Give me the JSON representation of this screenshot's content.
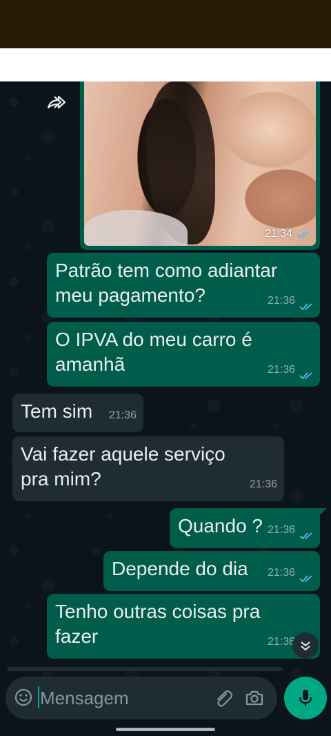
{
  "colors": {
    "outgoing_bubble": "#005c4b",
    "incoming_bubble": "#202c33",
    "chat_background": "#0b141a",
    "read_check": "#53bdeb",
    "accent": "#00a884"
  },
  "image_message": {
    "time": "21:34",
    "status_icon": "double-check-icon"
  },
  "messages": [
    {
      "direction": "outgoing",
      "line1": "Patrão tem como adiantar",
      "line2": "meu pagamento?",
      "time": "21:36"
    },
    {
      "direction": "outgoing",
      "line1": "O IPVA do meu carro é",
      "line2": "amanhã",
      "time": "21:36"
    },
    {
      "direction": "incoming",
      "line1": "Tem sim",
      "time": "21:36"
    },
    {
      "direction": "incoming",
      "line1": "Vai fazer aquele serviço",
      "line2": "pra mim?",
      "time": "21:36"
    },
    {
      "direction": "outgoing",
      "line1": "Quando ?",
      "time": "21:36"
    },
    {
      "direction": "outgoing",
      "line1": "Depende do dia",
      "time": "21:36"
    },
    {
      "direction": "outgoing",
      "line1": "Tenho outras coisas pra",
      "line2": "fazer",
      "time": "21:36"
    }
  ],
  "composer": {
    "placeholder": "Mensagem",
    "icons": [
      "emoji-icon",
      "paperclip-icon",
      "camera-icon",
      "microphone-icon"
    ]
  },
  "scroll_button_icon": "chevron-double-down-icon",
  "forward_icon": "forward-icon"
}
